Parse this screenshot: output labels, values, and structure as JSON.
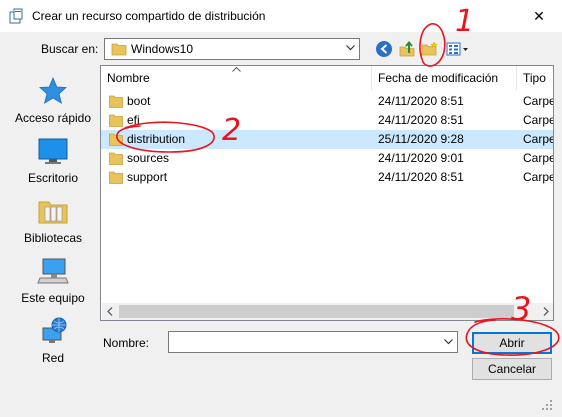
{
  "window": {
    "title": "Crear un recurso compartido de distribución",
    "close_glyph": "✕"
  },
  "toolbar": {
    "look_in_label": "Buscar en:",
    "look_in_value": "Windows10",
    "back_icon": "back-arrow-icon",
    "up_icon": "up-folder-icon",
    "new_folder_icon": "new-folder-icon",
    "views_icon": "view-menu-icon"
  },
  "places": [
    {
      "label": "Acceso rápido",
      "icon": "star-icon"
    },
    {
      "label": "Escritorio",
      "icon": "desktop-icon"
    },
    {
      "label": "Bibliotecas",
      "icon": "libraries-icon"
    },
    {
      "label": "Este equipo",
      "icon": "computer-icon"
    },
    {
      "label": "Red",
      "icon": "network-icon"
    }
  ],
  "list": {
    "columns": [
      "Nombre",
      "Fecha de modificación",
      "Tipo"
    ],
    "rows": [
      {
        "name": "boot",
        "date": "24/11/2020 8:51",
        "type": "Carpe"
      },
      {
        "name": "efi",
        "date": "24/11/2020 8:51",
        "type": "Carpe"
      },
      {
        "name": "distribution",
        "date": "25/11/2020 9:28",
        "type": "Carpe"
      },
      {
        "name": "sources",
        "date": "24/11/2020 9:01",
        "type": "Carpe"
      },
      {
        "name": "support",
        "date": "24/11/2020 8:51",
        "type": "Carpe"
      }
    ],
    "selected_row": "distribution"
  },
  "bottom": {
    "name_label": "Nombre:",
    "name_value": "",
    "open_label": "Abrir",
    "cancel_label": "Cancelar"
  },
  "annotations": [
    "1",
    "2",
    "3"
  ],
  "colors": {
    "selection": "#cce8ff",
    "annotation": "#e8141e",
    "accent": "#0078d7",
    "folder": "#e8c25a"
  }
}
